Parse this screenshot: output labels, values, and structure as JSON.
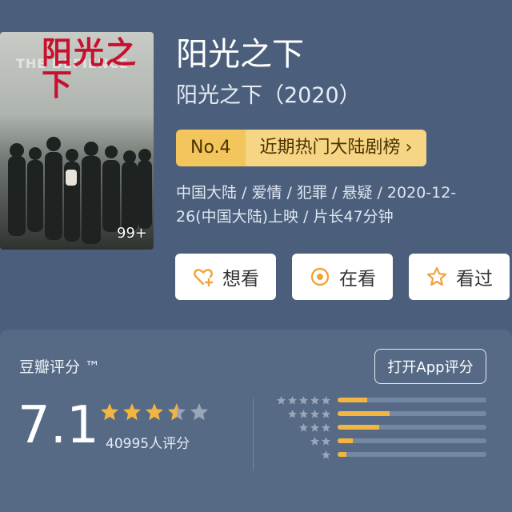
{
  "poster": {
    "title_text": "阳光之下",
    "en_text": "THE DEFIENCE",
    "badge": "99+"
  },
  "header": {
    "title": "阳光之下",
    "subtitle": "阳光之下（2020）"
  },
  "rank": {
    "number": "No.4",
    "list_name": "近期热门大陆剧榜",
    "chevron": "›"
  },
  "meta": {
    "line": "中国大陆 / 爱情 / 犯罪 / 悬疑 / 2020-12-26(中国大陆)上映 / 片长47分钟"
  },
  "actions": {
    "want": "想看",
    "watching": "在看",
    "watched": "看过"
  },
  "rating": {
    "label": "豆瓣评分 ™",
    "open_app": "打开App评分",
    "score": "7.1",
    "count": "40995人评分",
    "stars_value": 3.5,
    "distribution": [
      {
        "stars": 5,
        "fraction": 0.2
      },
      {
        "stars": 4,
        "fraction": 0.35
      },
      {
        "stars": 3,
        "fraction": 0.28
      },
      {
        "stars": 2,
        "fraction": 0.1
      },
      {
        "stars": 1,
        "fraction": 0.06
      }
    ]
  },
  "colors": {
    "background": "#4b5f7c",
    "accent_yellow": "#f2b640",
    "icon_orange": "#f2a23a",
    "star_grey": "#9aa6b8"
  }
}
